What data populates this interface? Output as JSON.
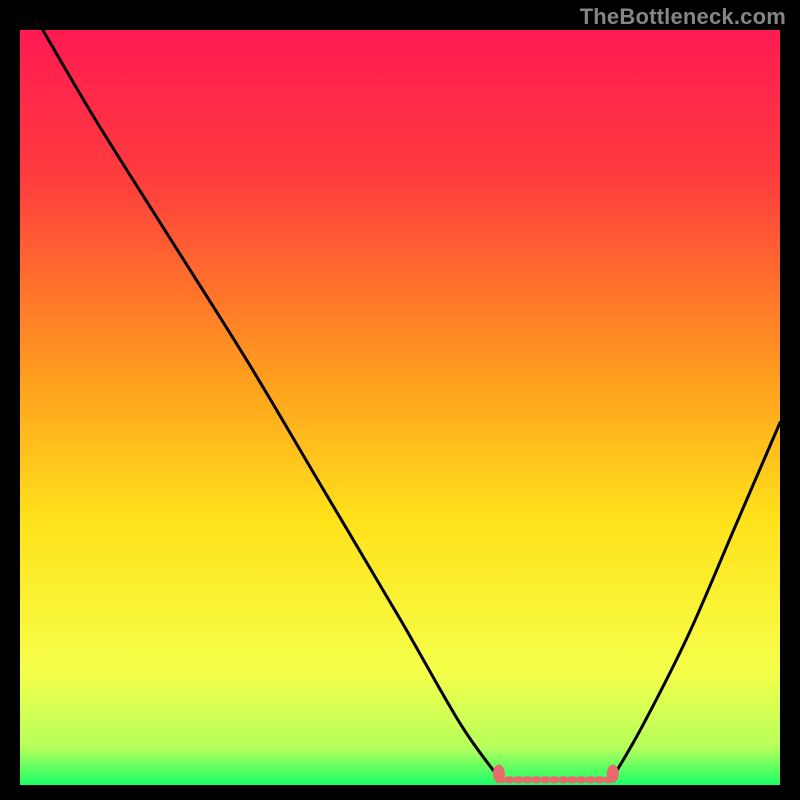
{
  "attribution": "TheBottleneck.com",
  "chart_data": {
    "type": "line",
    "title": "",
    "xlabel": "",
    "ylabel": "",
    "xlim": [
      0,
      100
    ],
    "ylim": [
      0,
      100
    ],
    "grid": false,
    "legend": false,
    "background_gradient": {
      "stops": [
        {
          "offset": 0.0,
          "color": "#ff1a52"
        },
        {
          "offset": 0.2,
          "color": "#ff3d3d"
        },
        {
          "offset": 0.45,
          "color": "#ff9a1f"
        },
        {
          "offset": 0.65,
          "color": "#ffe21a"
        },
        {
          "offset": 0.85,
          "color": "#f5ff4a"
        },
        {
          "offset": 0.95,
          "color": "#b6ff5c"
        },
        {
          "offset": 1.0,
          "color": "#1aff66"
        }
      ]
    },
    "series": [
      {
        "name": "bottleneck-curve-left",
        "x": [
          3,
          10,
          20,
          30,
          40,
          50,
          58,
          63
        ],
        "y": [
          100,
          88,
          72,
          56,
          39,
          22,
          8,
          1
        ]
      },
      {
        "name": "bottleneck-curve-right",
        "x": [
          78,
          82,
          88,
          94,
          100
        ],
        "y": [
          1,
          8,
          20,
          34,
          48
        ]
      },
      {
        "name": "bottleneck-flat",
        "x": [
          63,
          78
        ],
        "y": [
          0.7,
          0.7
        ],
        "style": "marker-dash",
        "color": "#e86a6a"
      }
    ],
    "markers": [
      {
        "x": 63,
        "y": 1.5,
        "color": "#e86a6a"
      },
      {
        "x": 78,
        "y": 1.5,
        "color": "#e86a6a"
      }
    ]
  }
}
